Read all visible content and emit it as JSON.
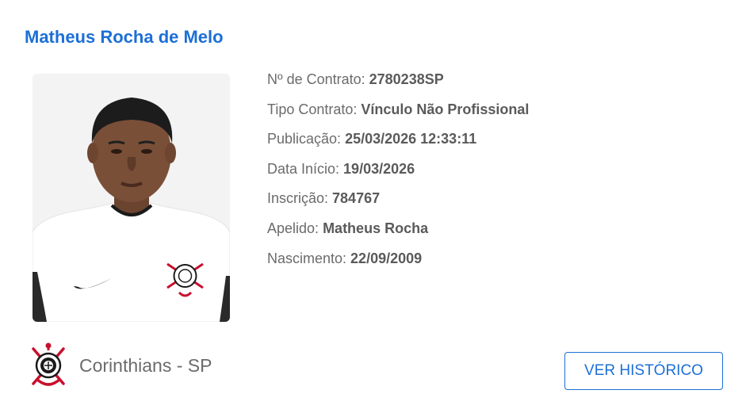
{
  "player": {
    "name": "Matheus Rocha de Melo"
  },
  "details": [
    {
      "label": "Nº de Contrato: ",
      "value": "2780238SP"
    },
    {
      "label": "Tipo Contrato: ",
      "value": "Vínculo Não Profissional"
    },
    {
      "label": "Publicação: ",
      "value": "25/03/2026 12:33:11"
    },
    {
      "label": "Data Início: ",
      "value": "19/03/2026"
    },
    {
      "label": "Inscrição: ",
      "value": "784767"
    },
    {
      "label": "Apelido: ",
      "value": "Matheus Rocha"
    },
    {
      "label": "Nascimento: ",
      "value": "22/09/2009"
    }
  ],
  "club": {
    "name": "Corinthians - SP",
    "badge_icon": "corinthians-crest-icon"
  },
  "actions": {
    "history_label": "VER HISTÓRICO"
  },
  "colors": {
    "accent": "#1c6fd6",
    "text": "#6b6b6b",
    "value_text": "#5a5a5a"
  }
}
